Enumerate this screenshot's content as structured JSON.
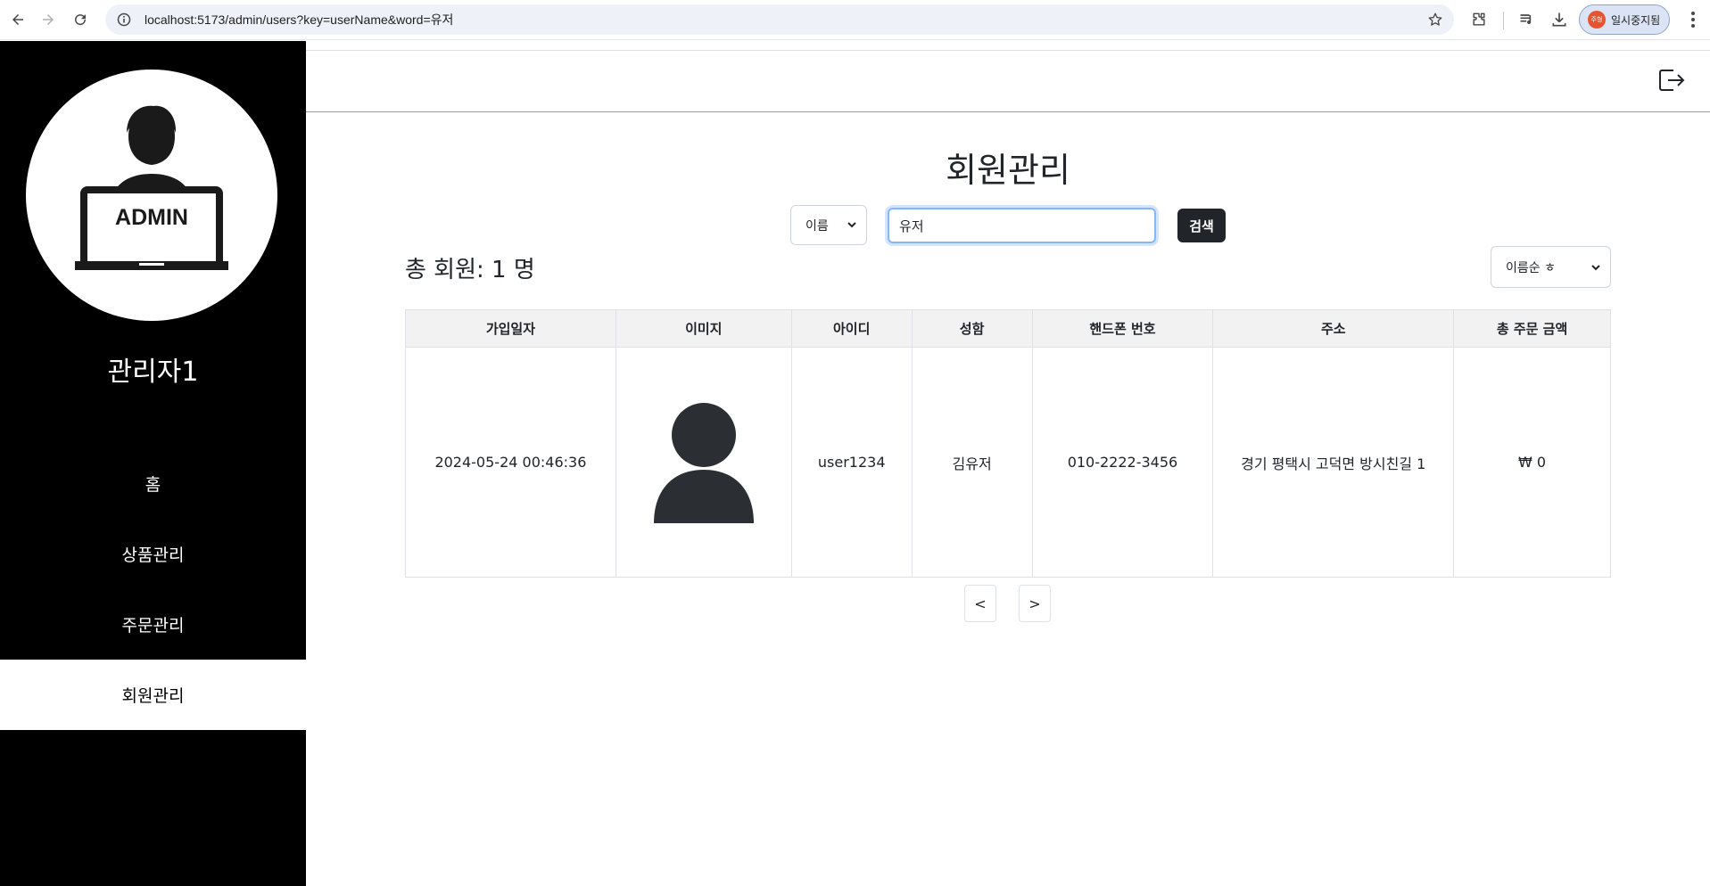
{
  "browser": {
    "url": "localhost:5173/admin/users?key=userName&word=유저",
    "profile_avatar_text": "주형",
    "profile_label": "일시중지됨"
  },
  "sidebar": {
    "admin_logo_text": "ADMIN",
    "admin_name": "관리자1",
    "items": [
      {
        "label": "홈"
      },
      {
        "label": "상품관리"
      },
      {
        "label": "주문관리"
      },
      {
        "label": "회원관리"
      }
    ],
    "active_index": 3
  },
  "main": {
    "title": "회원관리",
    "search": {
      "key_selected": "이름",
      "word_value": "유저",
      "button_label": "검색"
    },
    "total_label": "총 회원: 1 명",
    "sort_selected": "이름순 ㅎ",
    "table": {
      "headers": [
        "가입일자",
        "이미지",
        "아이디",
        "성함",
        "핸드폰 번호",
        "주소",
        "총 주문 금액"
      ],
      "rows": [
        {
          "joined": "2024-05-24 00:46:36",
          "image": "user-avatar-icon",
          "user_id": "user1234",
          "name": "김유저",
          "phone": "010-2222-3456",
          "address": "경기 평택시 고덕면 방시친길 1",
          "total_order": "₩ 0"
        }
      ]
    },
    "pager": {
      "prev_label": "<",
      "next_label": ">"
    }
  },
  "colors": {
    "sidebar_bg": "#000000",
    "primary_button": "#212529",
    "focus_ring": "#86b7fe"
  }
}
